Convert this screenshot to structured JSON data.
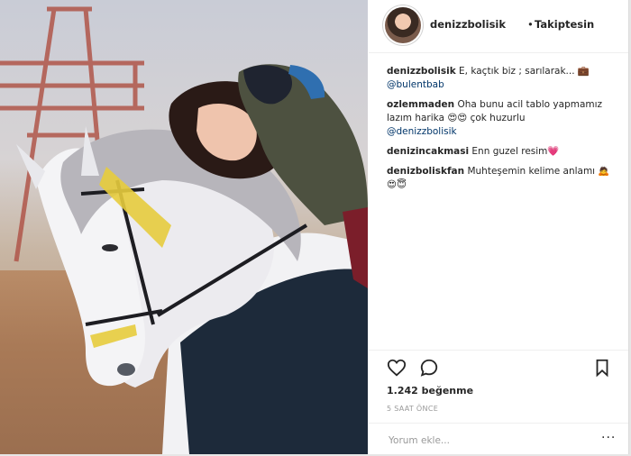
{
  "header": {
    "username": "denizzbolisik",
    "separator": "•",
    "follow_status": "Takiptesin"
  },
  "comments": [
    {
      "user": "denizzbolisik",
      "text": "E, kaçtık biz ; sarılarak... 💼",
      "mention": "@bulentbab"
    },
    {
      "user": "ozlemmaden",
      "text": "Oha bunu acil tablo yapmamız lazım harika 😍😍 çok huzurlu",
      "mention": "@denizzbolisik"
    },
    {
      "user": "denizincakmasi",
      "text": "Enn guzel resim💗",
      "mention": ""
    },
    {
      "user": "denizboliskfan",
      "text": "Muhteşemin kelime anlamı 🙇 😍😇",
      "mention": ""
    }
  ],
  "actions": {
    "likes": "1.242 beğenme",
    "time": "5 SAAT ÖNCE",
    "comment_placeholder": "Yorum ekle...",
    "more": "···"
  },
  "icons": {
    "like": "heart-icon",
    "comment": "comment-bubble-icon",
    "save": "bookmark-icon"
  },
  "colors": {
    "text": "#262626",
    "link": "#003569",
    "muted": "#999999",
    "border": "#efefef"
  }
}
